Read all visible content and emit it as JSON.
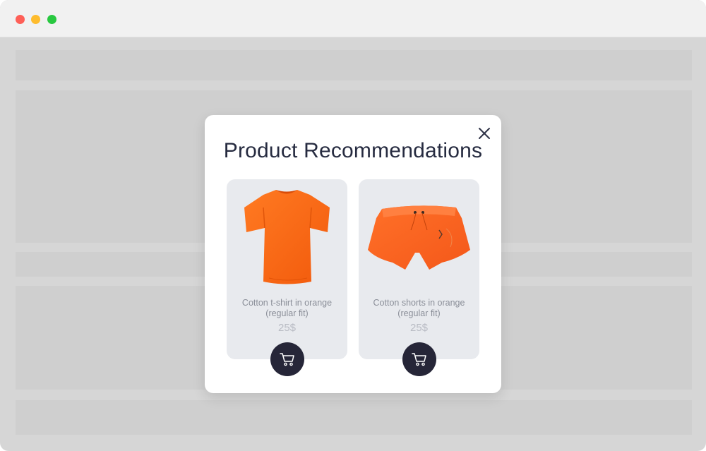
{
  "window": {
    "controls": [
      "close",
      "minimize",
      "zoom"
    ]
  },
  "modal": {
    "title": "Product Recommendations",
    "close_icon": "close-icon"
  },
  "products": [
    {
      "name": "Cotton t-shirt in orange (regular fit)",
      "price": "25$",
      "image_icon": "orange-tshirt-image",
      "cart_icon": "cart-icon"
    },
    {
      "name": "Cotton shorts in orange (regular fit)",
      "price": "25$",
      "image_icon": "orange-shorts-image",
      "cart_icon": "cart-icon"
    }
  ],
  "colors": {
    "product_orange": "#ff6a1a",
    "cart_button": "#262638",
    "title_text": "#262b40",
    "card_bg": "#e8eaee"
  }
}
